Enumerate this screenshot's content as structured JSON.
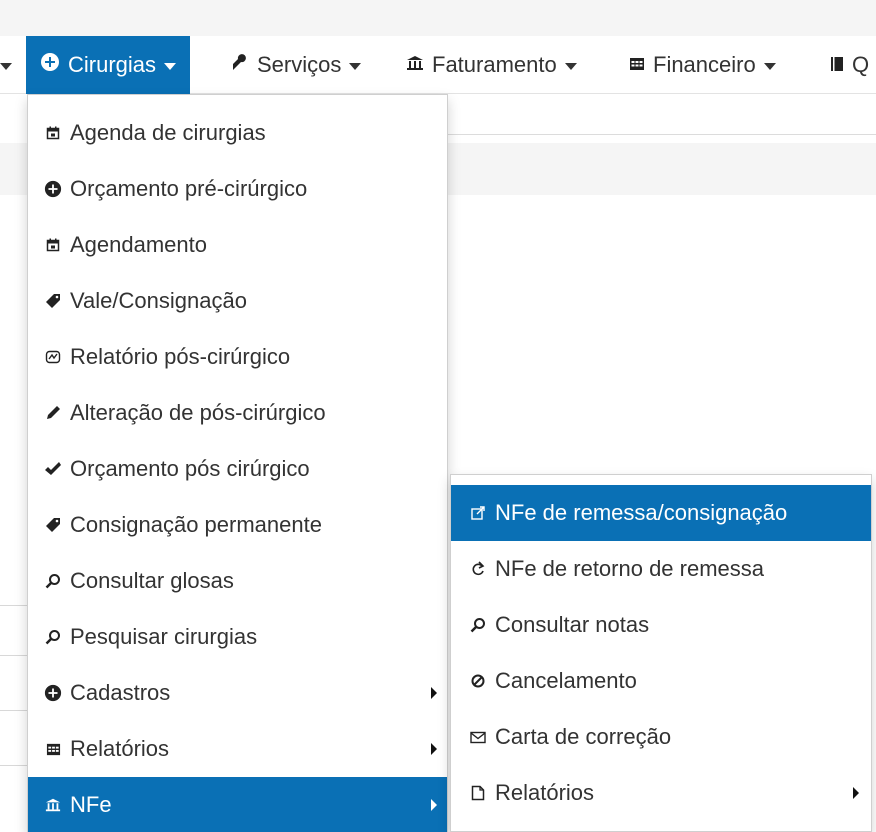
{
  "navbar": {
    "items": [
      {
        "label": "Cirurgias",
        "icon": "plus-circle-icon"
      },
      {
        "label": "Serviços",
        "icon": "wrench-icon"
      },
      {
        "label": "Faturamento",
        "icon": "bank-icon"
      },
      {
        "label": "Financeiro",
        "icon": "table-icon"
      },
      {
        "label": "Q",
        "icon": "book-icon"
      }
    ]
  },
  "cirurgias_menu": {
    "items": [
      {
        "label": "Agenda de cirurgias",
        "icon": "calendar-icon"
      },
      {
        "label": "Orçamento pré-cirúrgico",
        "icon": "plus-circle-icon"
      },
      {
        "label": "Agendamento",
        "icon": "calendar-icon"
      },
      {
        "label": "Vale/Consignação",
        "icon": "tag-icon"
      },
      {
        "label": "Relatório pós-cirúrgico",
        "icon": "report-icon"
      },
      {
        "label": "Alteração de pós-cirúrgico",
        "icon": "pencil-icon"
      },
      {
        "label": "Orçamento pós cirúrgico",
        "icon": "check-icon"
      },
      {
        "label": "Consignação permanente",
        "icon": "tag-icon"
      },
      {
        "label": "Consultar glosas",
        "icon": "search-icon"
      },
      {
        "label": "Pesquisar cirurgias",
        "icon": "search-icon"
      },
      {
        "label": "Cadastros",
        "icon": "plus-circle-icon"
      },
      {
        "label": "Relatórios",
        "icon": "table-icon"
      },
      {
        "label": "NFe",
        "icon": "bank-icon"
      }
    ]
  },
  "nfe_submenu": {
    "items": [
      {
        "label": "NFe de remessa/consignação",
        "icon": "external-link-icon"
      },
      {
        "label": "NFe de retorno de remessa",
        "icon": "return-icon"
      },
      {
        "label": "Consultar notas",
        "icon": "search-icon"
      },
      {
        "label": "Cancelamento",
        "icon": "ban-icon"
      },
      {
        "label": "Carta de correção",
        "icon": "envelope-icon"
      },
      {
        "label": "Relatórios",
        "icon": "document-icon"
      }
    ]
  },
  "colors": {
    "accent": "#0a70b5",
    "text": "#333333",
    "panel": "#f5f5f5"
  }
}
